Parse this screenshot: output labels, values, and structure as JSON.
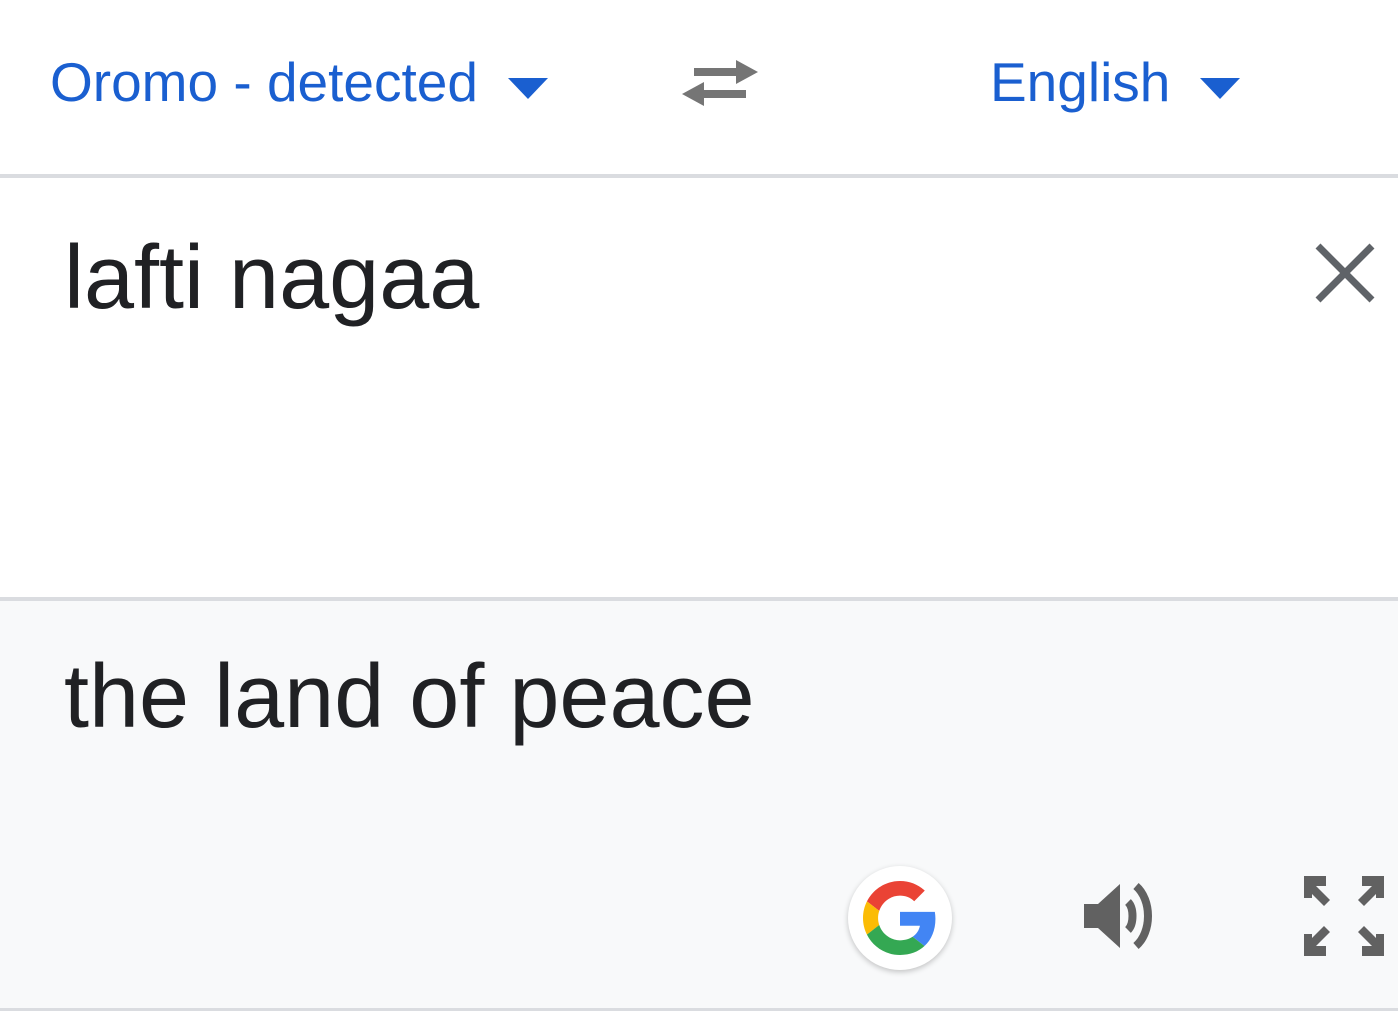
{
  "language_bar": {
    "source_language": "Oromo - detected",
    "target_language": "English"
  },
  "input": {
    "text": "lafti nagaa"
  },
  "output": {
    "text": "the land of peace"
  },
  "icons": {
    "source_dropdown": "chevron-down-icon",
    "target_dropdown": "chevron-down-icon",
    "swap": "swap-arrows-icon",
    "clear": "close-icon",
    "google": "google-g-logo",
    "speaker": "volume-icon",
    "fullscreen": "fullscreen-icon"
  },
  "colors": {
    "accent": "#1a5fd0",
    "text": "#202124",
    "icon_gray": "#757575",
    "output_background": "#f8f9fa",
    "divider": "#dadce0"
  }
}
